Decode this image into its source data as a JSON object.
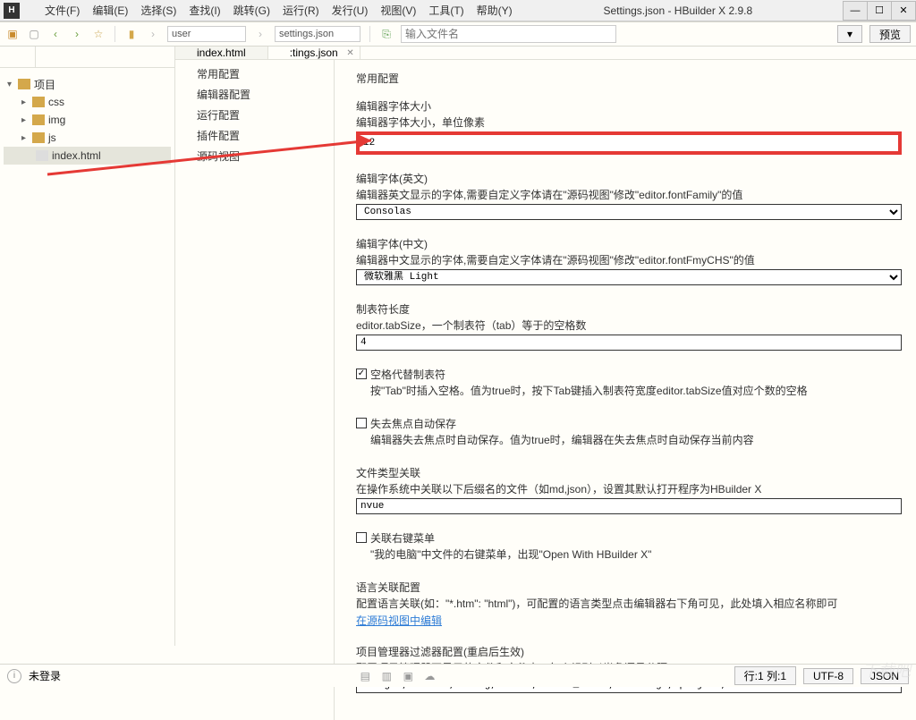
{
  "window": {
    "title": "Settings.json - HBuilder X 2.9.8"
  },
  "menu": [
    "文件(F)",
    "编辑(E)",
    "选择(S)",
    "查找(I)",
    "跳转(G)",
    "运行(R)",
    "发行(U)",
    "视图(V)",
    "工具(T)",
    "帮助(Y)"
  ],
  "toolbar": {
    "path_user": "user",
    "path_file": "settings.json",
    "search_ph": "输入文件名",
    "preview": "预览"
  },
  "tree": {
    "root": "项目",
    "folders": [
      "css",
      "img",
      "js"
    ],
    "file": "index.html"
  },
  "tabs": {
    "t1": "index.html",
    "t2": ":tings.json"
  },
  "cats": [
    "常用配置",
    "编辑器配置",
    "运行配置",
    "插件配置",
    "源码视图"
  ],
  "settings": {
    "title": "常用配置",
    "fontsize": {
      "label": "编辑器字体大小",
      "desc": "编辑器字体大小，单位像素",
      "value": "12"
    },
    "fonten": {
      "label": "编辑字体(英文)",
      "desc": "编辑器英文显示的字体,需要自定义字体请在\"源码视图\"修改\"editor.fontFamily\"的值",
      "value": "Consolas"
    },
    "fontcn": {
      "label": "编辑字体(中文)",
      "desc": "编辑器中文显示的字体,需要自定义字体请在\"源码视图\"修改\"editor.fontFmyCHS\"的值",
      "value": "微软雅黑 Light"
    },
    "tabsize": {
      "label": "制表符长度",
      "desc": "editor.tabSize，一个制表符（tab）等于的空格数",
      "value": "4"
    },
    "tabspace": {
      "label": "空格代替制表符",
      "desc": "按\"Tab\"时插入空格。值为true时，按下Tab键插入制表符宽度editor.tabSize值对应个数的空格"
    },
    "autosave": {
      "label": "失去焦点自动保存",
      "desc": "编辑器失去焦点时自动保存。值为true时，编辑器在失去焦点时自动保存当前内容"
    },
    "assoc": {
      "label": "文件类型关联",
      "desc": "在操作系统中关联以下后缀名的文件（如md,json），设置其默认打开程序为HBuilder X",
      "value": "nvue"
    },
    "ctxmenu": {
      "label": "关联右键菜单",
      "desc": "\"我的电脑\"中文件的右键菜单，出现\"Open With HBuilder X\""
    },
    "lang": {
      "label": "语言关联配置",
      "desc": "配置语言关联(如：\"*.htm\": \"html\")，可配置的语言类型点击编辑器右下角可见，此处填入相应名称即可",
      "link": "在源码视图中编辑"
    },
    "filter": {
      "label": "项目管理器过滤器配置(重启后生效)",
      "desc": "配置项目管理器不显示的文件和文件夹，每个规则以半角逗号分隔",
      "value": "**/.git,**/.svn,**/.hg,**/CVS,**/.DS_Store,.settings,.project,.HBuilder"
    }
  },
  "status": {
    "login": "未登录",
    "pos": "行:1 列:1",
    "enc": "UTF-8",
    "lang": "JSON"
  },
  "watermark": "下载吧"
}
